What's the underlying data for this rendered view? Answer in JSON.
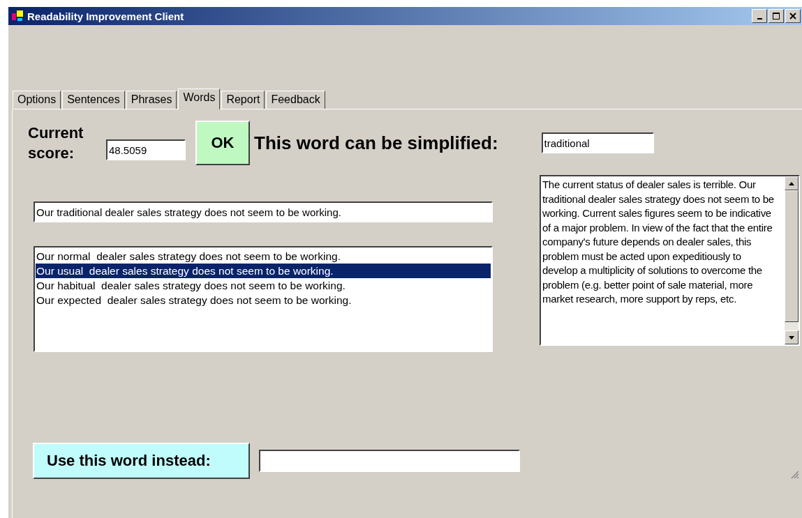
{
  "window": {
    "title": "Readability Improvement Client"
  },
  "tabs": [
    {
      "label": "Options",
      "selected": false
    },
    {
      "label": "Sentences",
      "selected": false
    },
    {
      "label": "Phrases",
      "selected": false
    },
    {
      "label": "Words",
      "selected": true
    },
    {
      "label": "Report",
      "selected": false
    },
    {
      "label": "Feedback",
      "selected": false
    }
  ],
  "score": {
    "label": "Current score:",
    "value": "48.5059"
  },
  "ok_button": "OK",
  "simplify": {
    "label": "This word can be simplified:",
    "value": "traditional"
  },
  "sentence": {
    "value": "Our traditional dealer sales strategy does not seem to be working."
  },
  "alternatives": [
    {
      "text": "Our normal  dealer sales strategy does not seem to be working.",
      "selected": false
    },
    {
      "text": "Our usual  dealer sales strategy does not seem to be working.",
      "selected": true
    },
    {
      "text": "Our habitual  dealer sales strategy does not seem to be working.",
      "selected": false
    },
    {
      "text": "Our expected  dealer sales strategy does not seem to be working.",
      "selected": false
    }
  ],
  "document": {
    "text": "The current status of dealer sales is terrible. Our traditional dealer sales strategy does not seem to be working. Current sales figures seem to be indicative of a major problem.  In view of the fact that the entire company's future depends on dealer sales, this problem must be acted upon expeditiously to develop a multiplicity of solutions to overcome the problem (e.g. better point of sale material, more market research, more support by reps, etc."
  },
  "replace": {
    "button": "Use this word instead:"
  }
}
